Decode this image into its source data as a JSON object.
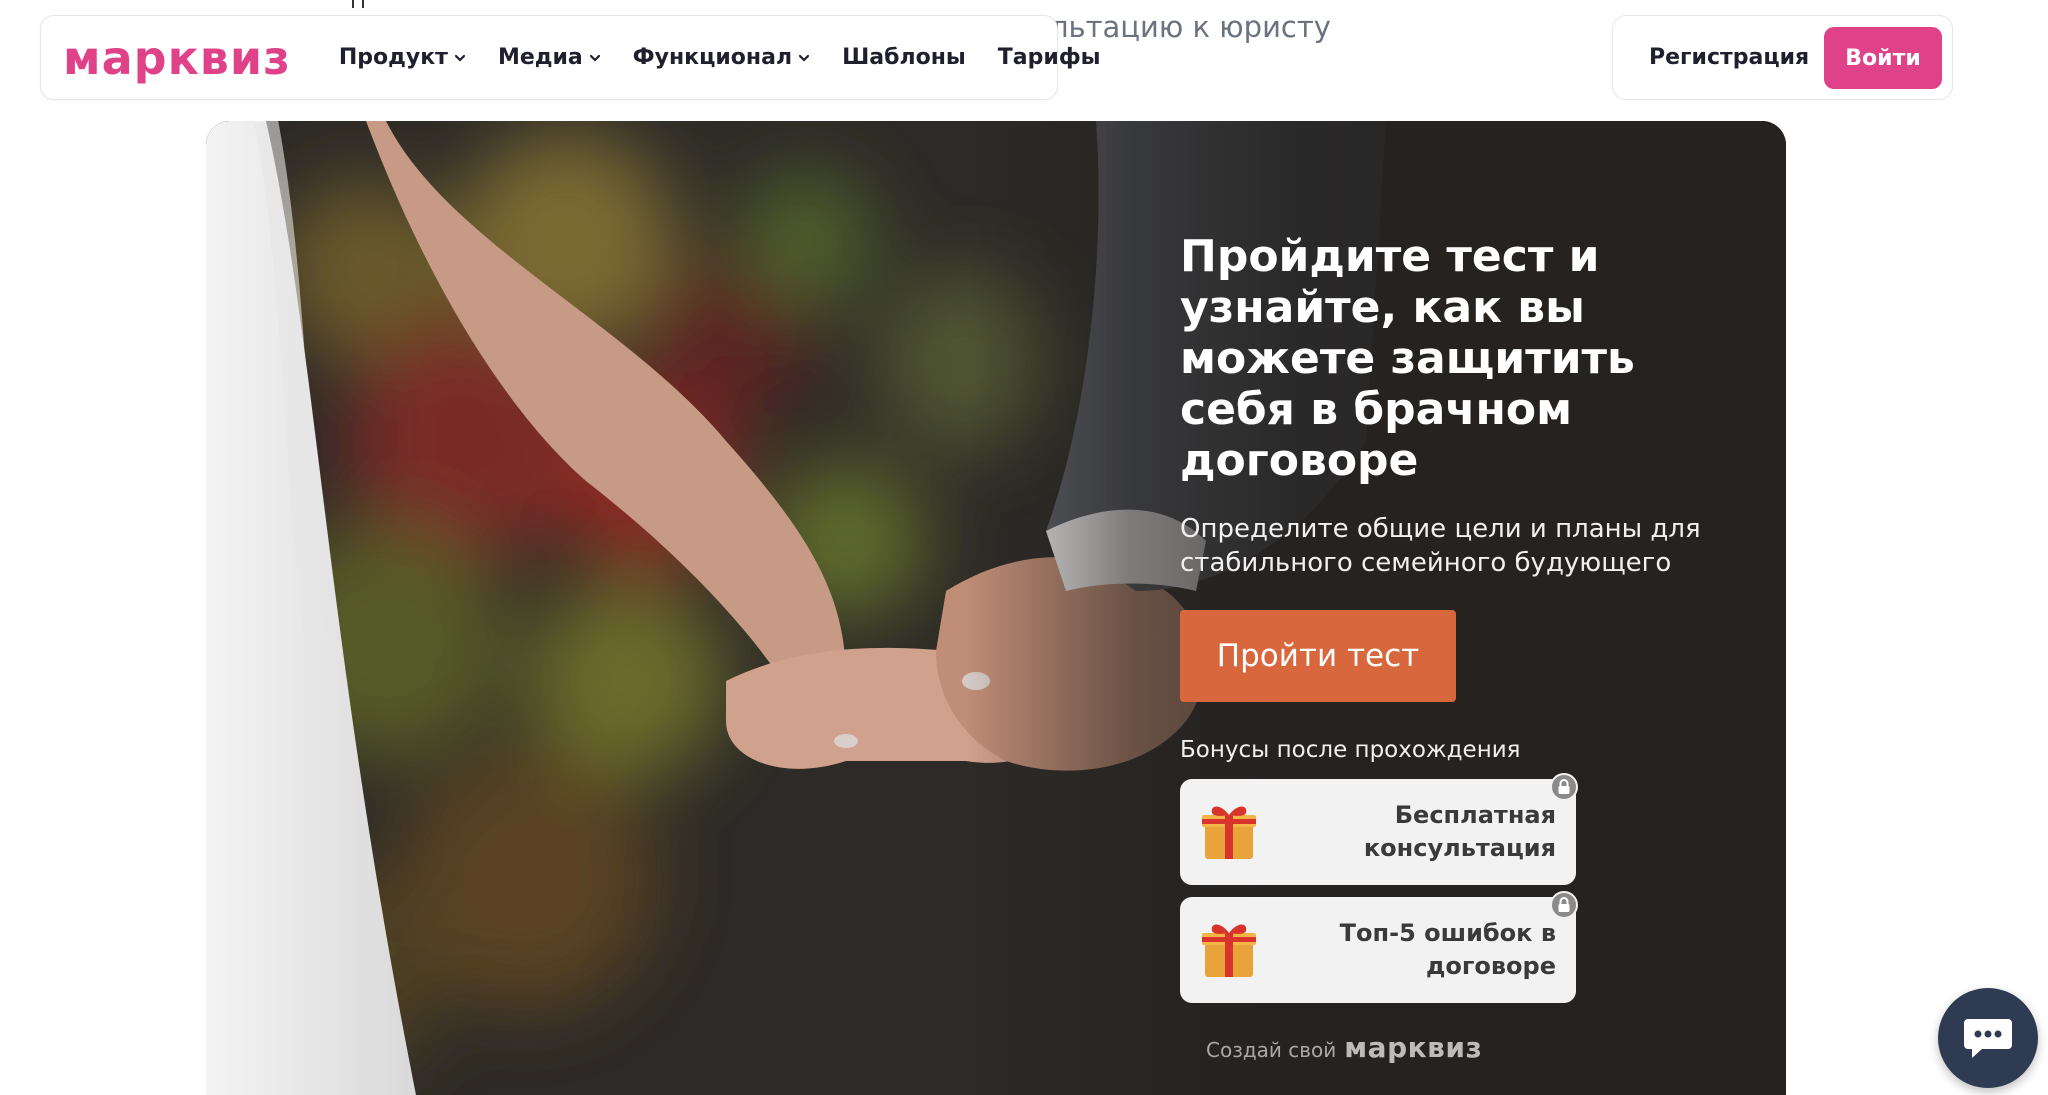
{
  "background": {
    "partial_text": "льтацию к юристу"
  },
  "header": {
    "logo": "марквиз",
    "nav": [
      {
        "label": "Продукт",
        "dropdown": true
      },
      {
        "label": "Медиа",
        "dropdown": true
      },
      {
        "label": "Функционал",
        "dropdown": true
      },
      {
        "label": "Шаблоны",
        "dropdown": false
      },
      {
        "label": "Тарифы",
        "dropdown": false
      }
    ],
    "register_label": "Регистрация",
    "login_label": "Войти"
  },
  "hero": {
    "title": "Пройдите тест и узнайте, как вы можете защитить себя в брачном договоре",
    "subtitle": "Определите общие цели и планы для стабильного семейного будующего",
    "cta_label": "Пройти тест",
    "bonus_title": "Бонусы после прохождения",
    "bonuses": [
      {
        "text_line1": "Бесплатная",
        "text_line2": "консультация",
        "icon": "gift-icon",
        "locked": true
      },
      {
        "text_line1": "Топ-5 ошибок в",
        "text_line2": "договоре",
        "icon": "gift-icon",
        "locked": true
      }
    ],
    "footer_prefix": "Создай свой",
    "footer_logo": "марквиз"
  },
  "colors": {
    "brand": "#e0428a",
    "cta": "#d8673d",
    "chat": "#2f3b52"
  },
  "chat": {
    "icon": "chat-bubble-icon"
  }
}
